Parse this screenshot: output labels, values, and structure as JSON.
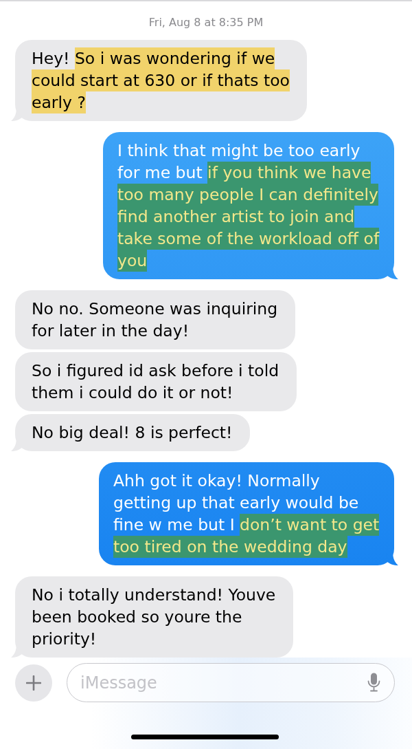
{
  "timestamp": "Fri, Aug 8 at 8:35 PM",
  "messages": [
    {
      "kind": "received",
      "segments": [
        {
          "text": "Hey! ",
          "highlighted": false
        },
        {
          "text": "So i was wondering if we could start at 630 or if thats too early ?",
          "highlighted": true
        }
      ]
    },
    {
      "kind": "sent",
      "segments": [
        {
          "text": "I think that might be too early for me but ",
          "highlighted": false
        },
        {
          "text": "if you think we have too many people I can definitely find another artist to join and take some of the workload off of you",
          "highlighted": true
        }
      ]
    },
    {
      "kind": "received",
      "segments": [
        {
          "text": "No no. Someone was inquiring for later in the day!",
          "highlighted": false
        }
      ]
    },
    {
      "kind": "received",
      "segments": [
        {
          "text": "So i figured id ask before i told them i could do it or not!",
          "highlighted": false
        }
      ]
    },
    {
      "kind": "received",
      "segments": [
        {
          "text": "No big deal! 8 is perfect!",
          "highlighted": false
        }
      ]
    },
    {
      "kind": "sent",
      "segments": [
        {
          "text": "Ahh got it okay! Normally getting up that early would be fine w me but I ",
          "highlighted": false
        },
        {
          "text": "don’t want to get too tired on the wedding day",
          "highlighted": true
        }
      ]
    },
    {
      "kind": "received",
      "segments": [
        {
          "text": "No i totally understand! Youve been booked so youre the priority!",
          "highlighted": false
        }
      ]
    }
  ],
  "composer": {
    "placeholder": "iMessage"
  }
}
